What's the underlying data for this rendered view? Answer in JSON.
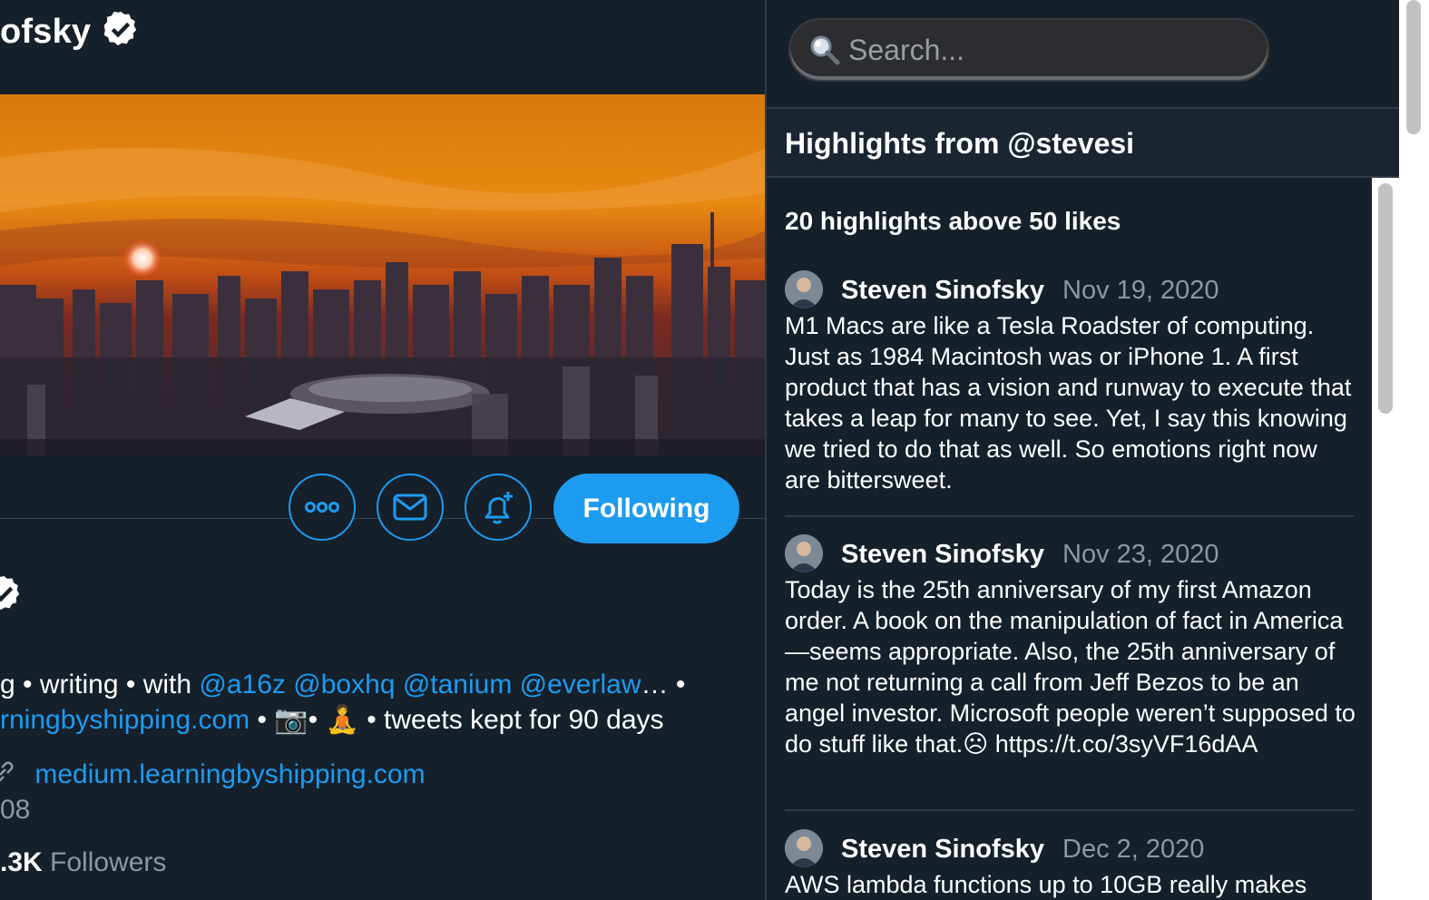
{
  "profile": {
    "name_partial": "ofsky",
    "bio_line1_prefix": "g • writing • with ",
    "bio_mentions": [
      "@a16z",
      "@boxhq",
      "@tanium",
      "@everlaw"
    ],
    "bio_line1_suffix": "… •",
    "bio_line2_link": "rningbyshipping.com",
    "bio_line2_mid": " • 📷• 🧘 • tweets kept for 90 days",
    "website": "medium.learningbyshipping.com",
    "joined_partial": "08",
    "followers_count": ".3K",
    "followers_label": "Followers"
  },
  "actions": {
    "following_label": "Following",
    "more_icon": "more-dots-icon",
    "message_icon": "envelope-icon",
    "notify_icon": "bell-plus-icon"
  },
  "search": {
    "placeholder": "Search..."
  },
  "highlights": {
    "header": "Highlights from @stevesi",
    "count_text": "20 highlights above 50 likes",
    "tweets": [
      {
        "author": "Steven Sinofsky",
        "date": "Nov 19, 2020",
        "text": "M1 Macs are like a Tesla Roadster of computing. Just as 1984 Macintosh was or iPhone 1. A first product that has a vision and runway to execute that takes a leap for many to see. Yet, I say this knowing we tried to do that as well. So emotions right now are bittersweet."
      },
      {
        "author": "Steven Sinofsky",
        "date": "Nov 23, 2020",
        "text": "Today is the 25th anniversary of my first Amazon order. A book on the manipulation of fact in America—seems appropriate. Also, the 25th anniversary of me not returning a call from Jeff Bezos to be an angel investor. Microsoft people weren’t supposed to do stuff like that.☹︎ https://t.co/3syVF16dAA"
      },
      {
        "author": "Steven Sinofsky",
        "date": "Dec 2, 2020",
        "text": "AWS lambda functions up to 10GB really makes"
      }
    ]
  },
  "colors": {
    "accent": "#1d9bf0",
    "background": "#15202b",
    "muted": "#8b98a5"
  }
}
